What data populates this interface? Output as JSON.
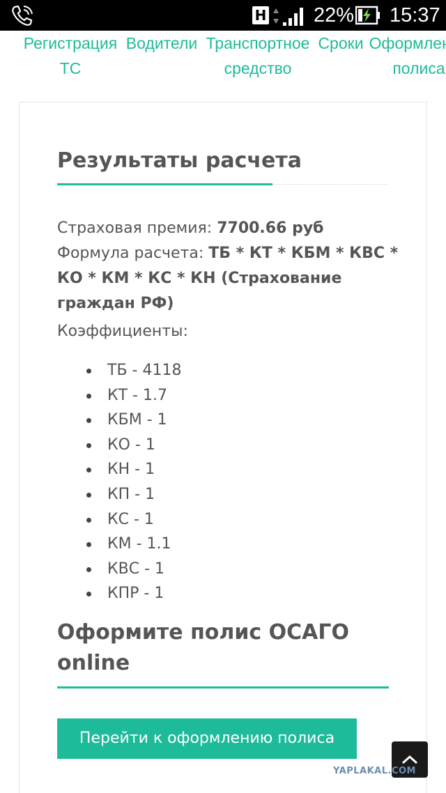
{
  "status_bar": {
    "network_badge": "H",
    "battery_percent": "22%",
    "time": "15:37"
  },
  "steps": [
    {
      "line1": "Регистрация",
      "line2": "ТС"
    },
    {
      "line1": "Водители",
      "line2": ""
    },
    {
      "line1": "Транспортное",
      "line2": "средство"
    },
    {
      "line1": "Сроки",
      "line2": ""
    },
    {
      "line1": "Оформление",
      "line2": "полиса"
    }
  ],
  "results": {
    "title": "Результаты расчета",
    "premium_label": "Страховая премия: ",
    "premium_value": "7700.66 руб",
    "formula_label": "Формула расчета: ",
    "formula_value": "ТБ * КТ * КБМ * КВС * КО * КМ * КС * КН (Страхование граждан РФ)",
    "coefficients_title": "Коэффициенты:",
    "coefficients": [
      "ТБ - 4118",
      "КТ - 1.7",
      "КБМ - 1",
      "КО - 1",
      "КН - 1",
      "КП - 1",
      "КС - 1",
      "КМ - 1.1",
      "КВС - 1",
      "КПР - 1"
    ]
  },
  "order": {
    "title": "Оформите полис ОСАГО online",
    "button_label": "Перейти к оформлению полиса"
  },
  "watermark": "YAPLAKAL.COM",
  "colors": {
    "accent": "#1dbb9a",
    "text": "#555555",
    "status_bar": "#000000"
  },
  "icons": [
    "phone-call-icon",
    "signal-icon",
    "battery-charging-icon",
    "arrow-up-icon"
  ]
}
